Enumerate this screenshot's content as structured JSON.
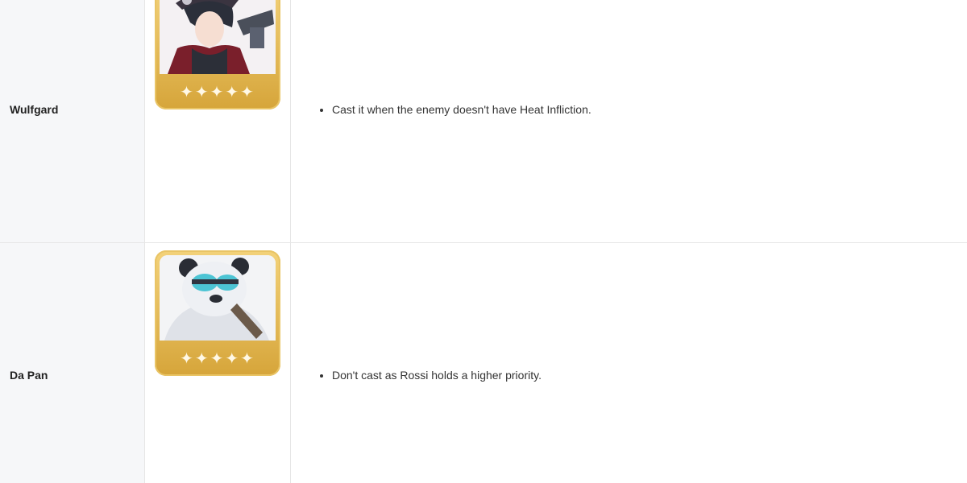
{
  "rows": [
    {
      "name": "Wulfgard",
      "rarity_stars": "✦✦✦✦✦",
      "notes": [
        "Cast it when the enemy doesn't have Heat Infliction."
      ]
    },
    {
      "name": "Da Pan",
      "rarity_stars": "✦✦✦✦✦",
      "notes": [
        "Don't cast as Rossi holds a higher priority."
      ]
    }
  ],
  "colors": {
    "card_gold": "#d6a53a",
    "name_column_bg": "#f6f7f9",
    "divider": "#e6e6e6"
  },
  "icons": {
    "portrait_1": "wulfgard-portrait-icon",
    "portrait_2": "da-pan-portrait-icon",
    "rarity": "star-icon"
  }
}
